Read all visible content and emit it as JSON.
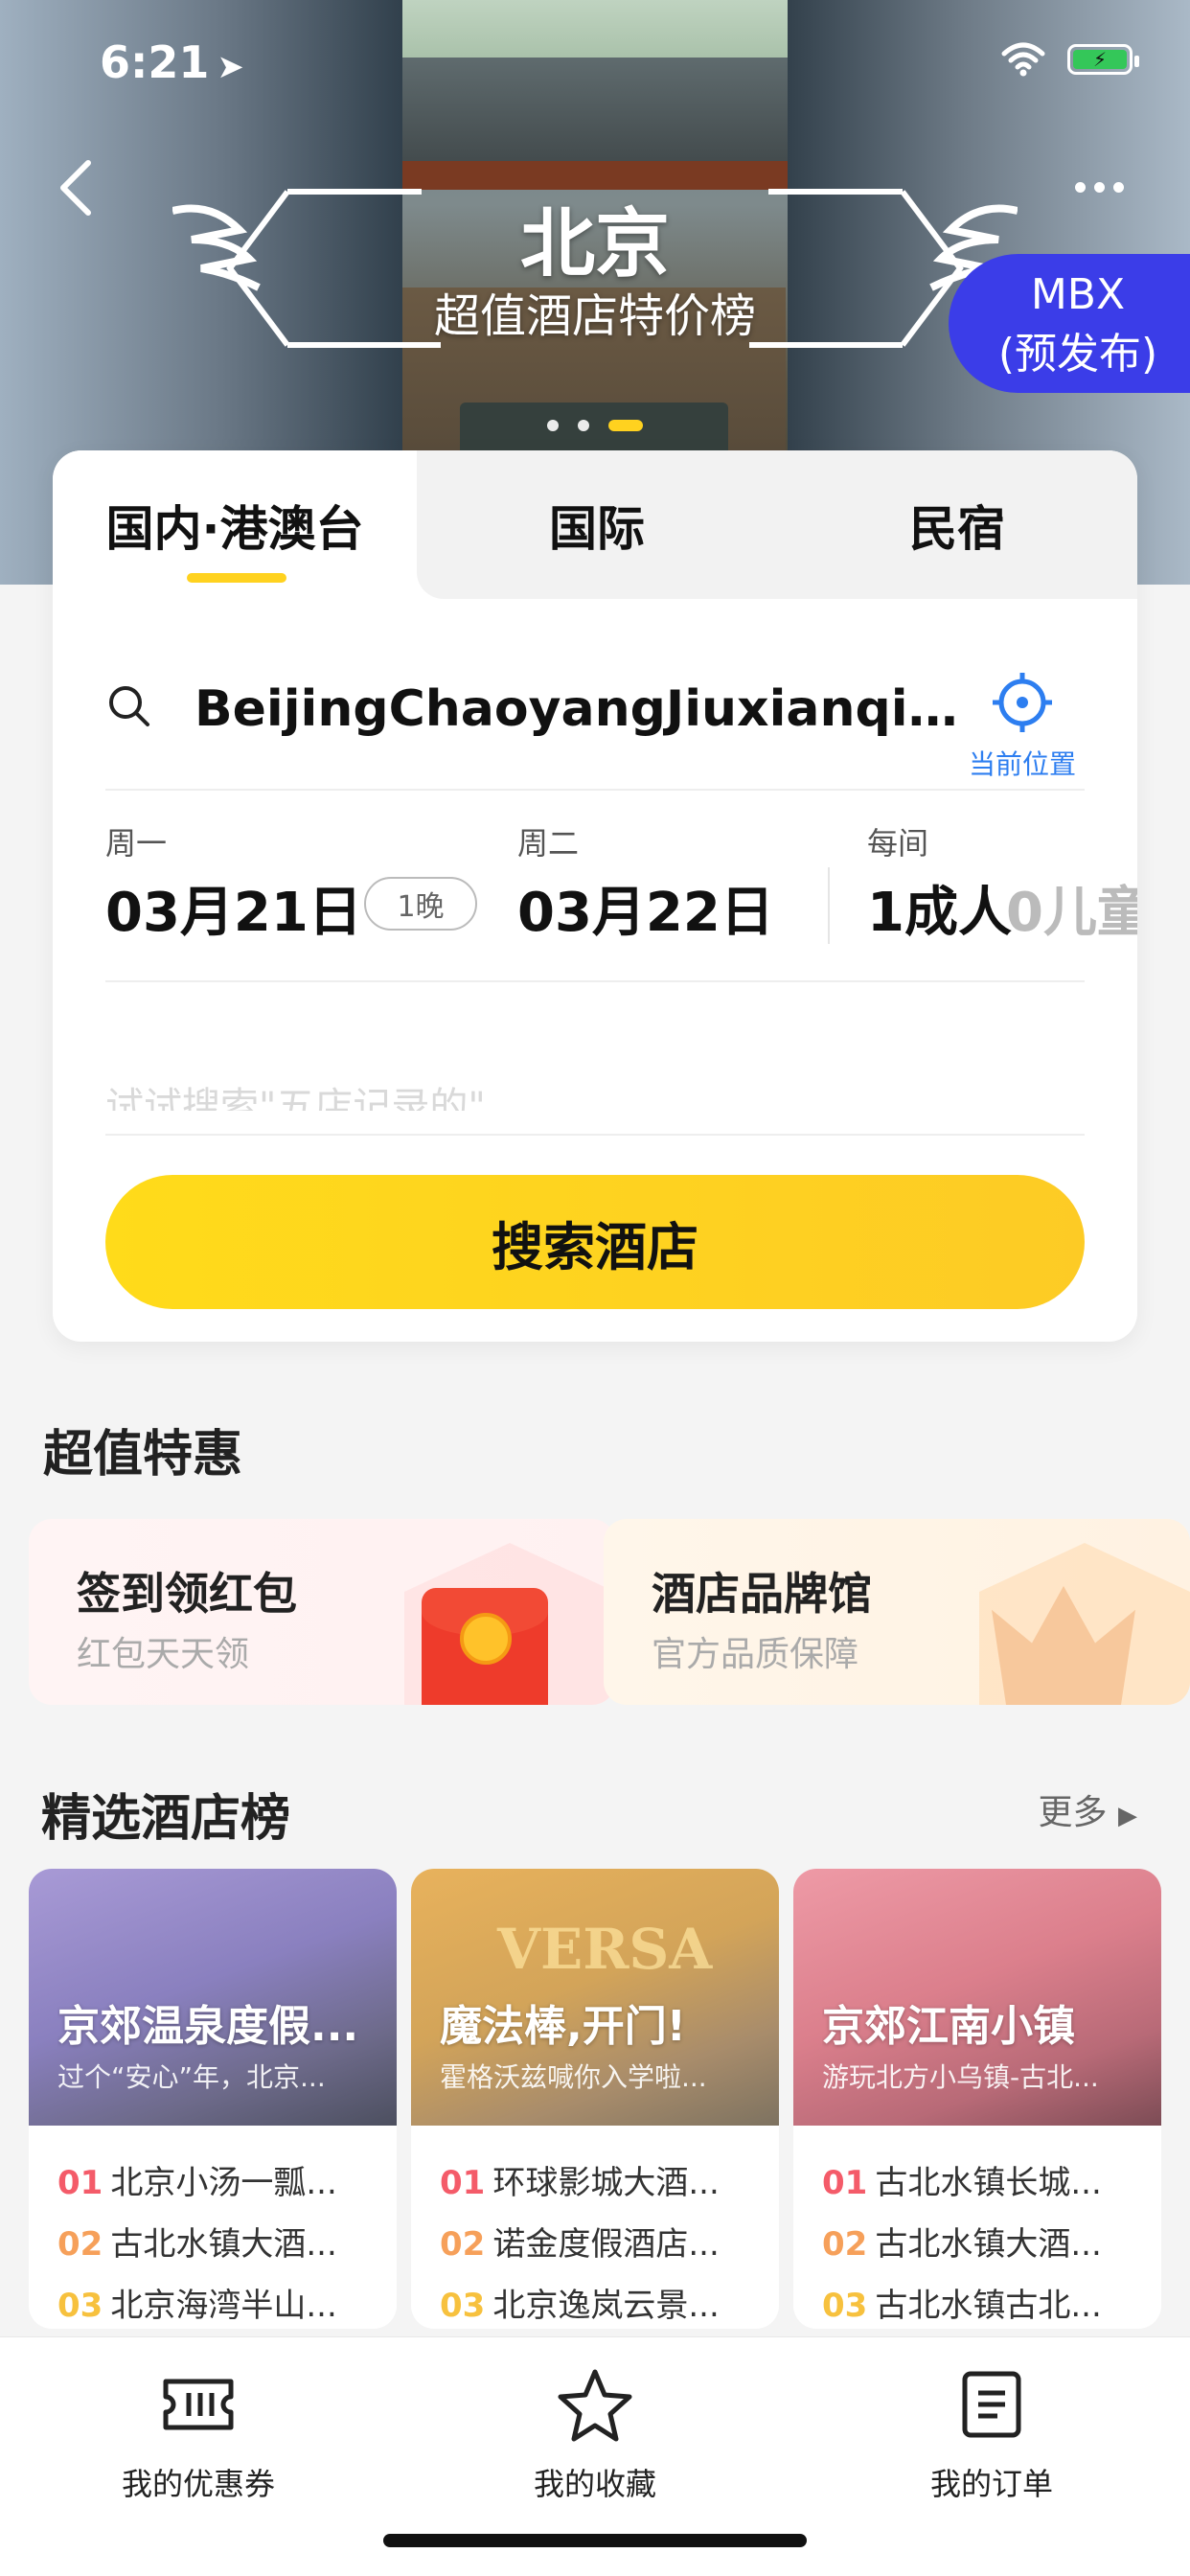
{
  "status_bar": {
    "time": "6:21",
    "location_arrow": "➤"
  },
  "hero": {
    "city": "北京",
    "subtitle": "超值酒店特价榜",
    "slides_total": 3,
    "slide_active": 3,
    "badge_line1": "MBX",
    "badge_line2": "(预发布)"
  },
  "tabs": [
    {
      "label": "国内·港澳台",
      "active": true
    },
    {
      "label": "国际",
      "active": false
    },
    {
      "label": "民宿",
      "active": false
    }
  ],
  "search": {
    "destination": "BeijingChaoyangJiuxianqiao...",
    "current_location_label": "当前位置"
  },
  "dates": {
    "checkin_weekday": "周一",
    "checkin_date": "03月21日",
    "nights": "1晚",
    "checkout_weekday": "周二",
    "checkout_date": "03月22日",
    "per_room_label": "每间",
    "adults": "1成人",
    "children": "0儿童"
  },
  "keyword": {
    "placeholder": "试试搜索\"五店记录的\""
  },
  "search_button": "搜索酒店",
  "deals": {
    "title": "超值特惠",
    "items": [
      {
        "title": "签到领红包",
        "subtitle": "红包天天领",
        "icon": "red-envelope-icon"
      },
      {
        "title": "酒店品牌馆",
        "subtitle": "官方品质保障",
        "icon": "crown-icon"
      }
    ]
  },
  "rankings": {
    "title": "精选酒店榜",
    "more_label": "更多",
    "cards": [
      {
        "title": "京郊温泉度假...",
        "subtitle": "过个“安心”年，北京...",
        "items": [
          {
            "rank": "01",
            "name": "北京小汤一瓢..."
          },
          {
            "rank": "02",
            "name": "古北水镇大酒..."
          },
          {
            "rank": "03",
            "name": "北京海湾半山..."
          }
        ]
      },
      {
        "title": "魔法棒,开门!",
        "subtitle": "霍格沃兹喊你入学啦...",
        "image_text": "VERSA",
        "items": [
          {
            "rank": "01",
            "name": "环球影城大酒..."
          },
          {
            "rank": "02",
            "name": "诺金度假酒店..."
          },
          {
            "rank": "03",
            "name": "北京逸岚云景..."
          }
        ]
      },
      {
        "title": "京郊江南小镇",
        "subtitle": "游玩北方小乌镇-古北...",
        "items": [
          {
            "rank": "01",
            "name": "古北水镇长城..."
          },
          {
            "rank": "02",
            "name": "古北水镇大酒..."
          },
          {
            "rank": "03",
            "name": "古北水镇古北..."
          }
        ]
      }
    ]
  },
  "bottom_bar": [
    {
      "label": "我的优惠券",
      "icon": "coupon-icon"
    },
    {
      "label": "我的收藏",
      "icon": "star-icon"
    },
    {
      "label": "我的订单",
      "icon": "order-icon"
    }
  ],
  "colors": {
    "accent_yellow": "#ffd21f",
    "location_blue": "#2d7ef0",
    "badge_blue": "#3b3de8"
  }
}
